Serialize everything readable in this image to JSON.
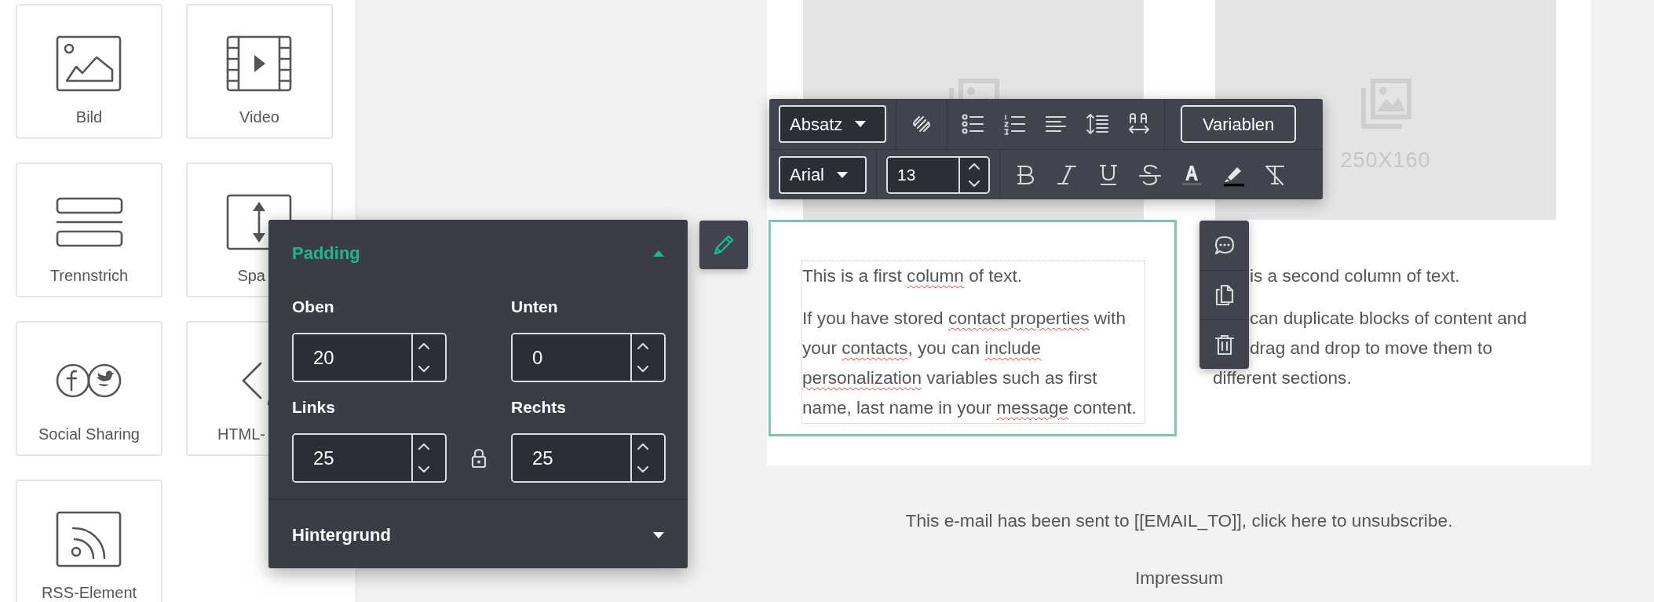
{
  "sidebar": {
    "tiles": [
      {
        "label": "Bild",
        "kind": "image",
        "clipped": false
      },
      {
        "label": "Video",
        "kind": "video",
        "clipped": false
      },
      {
        "label": "Trennstrich",
        "kind": "divider",
        "clipped": false
      },
      {
        "label": "Spa",
        "kind": "spacer",
        "clipped": true
      },
      {
        "label": "Social Sharing",
        "kind": "social",
        "clipped": false
      },
      {
        "label": "HTML-",
        "kind": "html",
        "clipped": true
      },
      {
        "label": "RSS-Element",
        "kind": "rss",
        "clipped": false
      }
    ]
  },
  "email": {
    "images": [
      {
        "kind": "image-placeholder"
      },
      {
        "kind": "image-placeholder",
        "caption": "250X160"
      }
    ],
    "columns": [
      {
        "selected": true,
        "paragraphs": [
          {
            "lines": [
              {
                "covered": false,
                "runs": [
                  {
                    "text": "This is a first ",
                    "misspelled": false
                  },
                  {
                    "text": "column",
                    "misspelled": true
                  },
                  {
                    "text": " of text.",
                    "misspelled": false
                  }
                ]
              }
            ]
          },
          {
            "lines": [
              {
                "covered": false,
                "runs": [
                  {
                    "text": "If you have stored ",
                    "misspelled": false
                  },
                  {
                    "text": "contact",
                    "misspelled": true
                  },
                  {
                    "text": " properties",
                    "misspelled": true
                  },
                  {
                    "text": " with",
                    "misspelled": false
                  }
                ]
              },
              {
                "covered": false,
                "runs": [
                  {
                    "text": "your ",
                    "misspelled": false
                  },
                  {
                    "text": "contacts",
                    "misspelled": true
                  },
                  {
                    "text": ", you can ",
                    "misspelled": false
                  },
                  {
                    "text": "include",
                    "misspelled": true
                  }
                ]
              },
              {
                "covered": false,
                "runs": [
                  {
                    "text": "personalization",
                    "misspelled": true
                  },
                  {
                    "text": " variables such as first",
                    "misspelled": false
                  }
                ]
              },
              {
                "covered": false,
                "runs": [
                  {
                    "text": "name, last name in your ",
                    "misspelled": false
                  },
                  {
                    "text": "message",
                    "misspelled": true
                  },
                  {
                    "text": " content.",
                    "misspelled": false
                  }
                ]
              }
            ]
          }
        ]
      },
      {
        "selected": false,
        "paragraphs": [
          {
            "lines": [
              {
                "covered": true,
                "runs": [
                  {
                    "text": "is a second column of text.",
                    "misspelled": false
                  }
                ]
              }
            ]
          },
          {
            "lines": [
              {
                "covered": true,
                "runs": [
                  {
                    "text": "can duplicate blocks of content and",
                    "misspelled": false
                  }
                ]
              },
              {
                "covered": true,
                "runs": [
                  {
                    "text": "drag and drop to move them to",
                    "misspelled": false
                  }
                ]
              },
              {
                "covered": false,
                "runs": [
                  {
                    "text": "different sections.",
                    "misspelled": false
                  }
                ]
              }
            ]
          }
        ]
      }
    ],
    "footer": {
      "notice": "This e-mail has been sent to [[EMAIL_TO]], click here to unsubscribe.",
      "link": "Impressum"
    }
  },
  "toolbar": {
    "block_format": "Absatz",
    "font": "Arial",
    "font_size": "13",
    "variables_button": "Variablen"
  },
  "settings_panel": {
    "sections": [
      {
        "title": "Padding",
        "expanded": true,
        "fields": [
          {
            "label": "Oben",
            "value": "20"
          },
          {
            "label": "Unten",
            "value": "0"
          },
          {
            "label": "Links",
            "value": "25"
          },
          {
            "label": "Rechts",
            "value": "25"
          }
        ]
      },
      {
        "title": "Hintergrund",
        "expanded": false
      }
    ]
  }
}
